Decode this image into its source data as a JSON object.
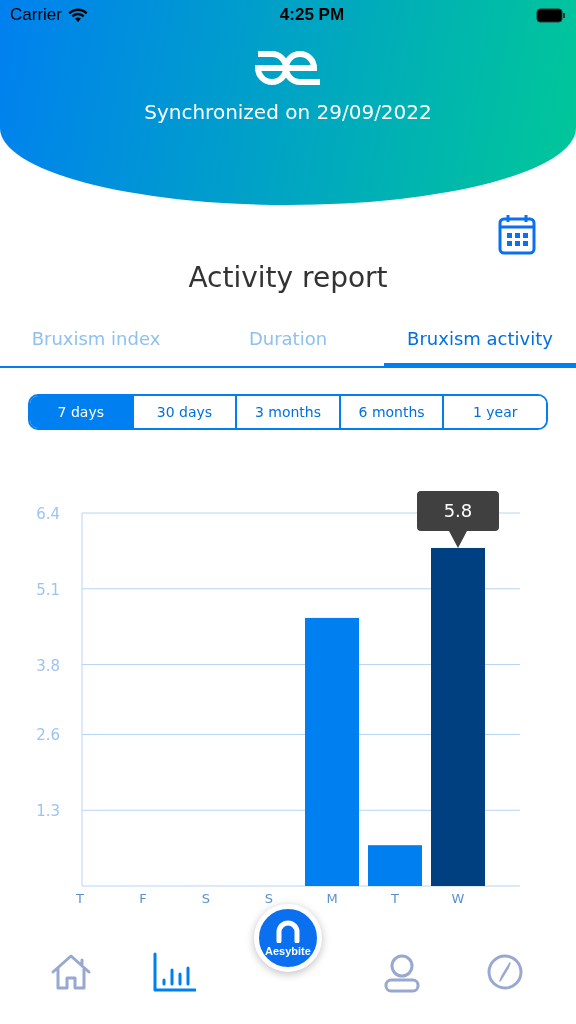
{
  "status_bar": {
    "carrier": "Carrier",
    "time": "4:25 PM"
  },
  "header": {
    "sync_text": "Synchronized on 29/09/2022"
  },
  "title": "Activity report",
  "tabs": [
    {
      "label": "Bruxism index",
      "selected": false
    },
    {
      "label": "Duration",
      "selected": false
    },
    {
      "label": "Bruxism activity",
      "selected": true
    }
  ],
  "periods": [
    {
      "label": "7 days",
      "selected": true
    },
    {
      "label": "30 days",
      "selected": false
    },
    {
      "label": "3 months",
      "selected": false
    },
    {
      "label": "6 months",
      "selected": false
    },
    {
      "label": "1 year",
      "selected": false
    }
  ],
  "chart_data": {
    "type": "bar",
    "categories": [
      "T",
      "F",
      "S",
      "S",
      "M",
      "T",
      "W"
    ],
    "series": [
      {
        "color": "#0080f0",
        "values": [
          0,
          0,
          0,
          0,
          4.6,
          0.7,
          null
        ]
      },
      {
        "color": "#004080",
        "values": [
          null,
          null,
          null,
          null,
          null,
          null,
          5.8
        ]
      }
    ],
    "ylim": [
      0,
      6.4
    ],
    "yticks": [
      1.3,
      2.6,
      3.8,
      5.1,
      6.4
    ],
    "grid": true,
    "annotations": [
      {
        "x": "W",
        "y": 5.8,
        "text": "5.8"
      }
    ]
  },
  "nav": [
    {
      "kind": "home",
      "selected": false
    },
    {
      "kind": "chart",
      "selected": true
    },
    {
      "kind": "center",
      "label": "Aesybite",
      "selected": false
    },
    {
      "kind": "profile",
      "selected": false
    },
    {
      "kind": "compass",
      "selected": false
    }
  ]
}
